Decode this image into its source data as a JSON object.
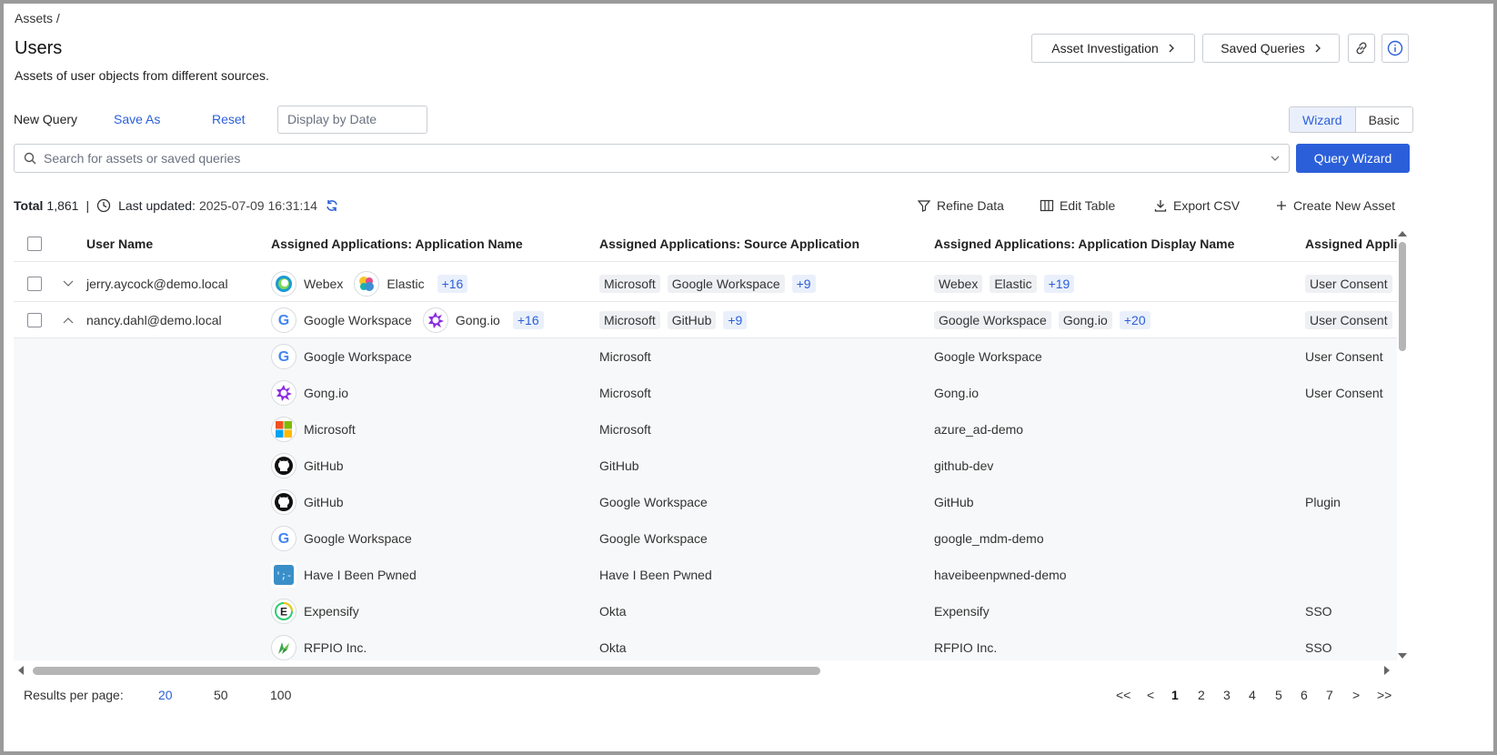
{
  "breadcrumb": "Assets /",
  "page": {
    "title": "Users",
    "subtitle": "Assets of user objects from different sources."
  },
  "header_buttons": {
    "asset_investigation": "Asset Investigation",
    "saved_queries": "Saved Queries"
  },
  "query_bar": {
    "new_query": "New Query",
    "save_as": "Save As",
    "reset": "Reset",
    "display_by_date_placeholder": "Display by Date",
    "mode_wizard": "Wizard",
    "mode_basic": "Basic",
    "search_placeholder": "Search for assets or saved queries",
    "query_wizard": "Query Wizard"
  },
  "status": {
    "total_label": "Total",
    "total_value": "1,861",
    "separator": "|",
    "last_updated_label": "Last updated:",
    "last_updated_value": "2025-07-09 16:31:14"
  },
  "toolbar": {
    "refine_data": "Refine Data",
    "edit_table": "Edit Table",
    "export_csv": "Export CSV",
    "create_new_asset": "Create New Asset"
  },
  "columns": {
    "user_name": "User Name",
    "app_name": "Assigned Applications: Application Name",
    "source_app": "Assigned Applications: Source Application",
    "display_name": "Assigned Applications: Application Display Name",
    "assigned_applic": "Assigned Applic"
  },
  "rows": [
    {
      "user": "jerry.aycock@demo.local",
      "app1": "Webex",
      "app2": "Elastic",
      "app_more": "+16",
      "src1": "Microsoft",
      "src2": "Google Workspace",
      "src_more": "+9",
      "disp1": "Webex",
      "disp2": "Elastic",
      "disp_more": "+19",
      "extra": "User Consent"
    },
    {
      "user": "nancy.dahl@demo.local",
      "app1": "Google Workspace",
      "app2": "Gong.io",
      "app_more": "+16",
      "src1": "Microsoft",
      "src2": "GitHub",
      "src_more": "+9",
      "disp1": "Google Workspace",
      "disp2": "Gong.io",
      "disp_more": "+20",
      "extra": "User Consent"
    }
  ],
  "subrows": [
    {
      "app": "Google Workspace",
      "icon": "google-icon",
      "source": "Microsoft",
      "display": "Google Workspace",
      "extra": "User Consent"
    },
    {
      "app": "Gong.io",
      "icon": "gong-icon",
      "source": "Microsoft",
      "display": "Gong.io",
      "extra": "User Consent"
    },
    {
      "app": "Microsoft",
      "icon": "microsoft-icon",
      "source": "Microsoft",
      "display": "azure_ad-demo",
      "extra": ""
    },
    {
      "app": "GitHub",
      "icon": "github-icon",
      "source": "GitHub",
      "display": "github-dev",
      "extra": ""
    },
    {
      "app": "GitHub",
      "icon": "github-icon",
      "source": "Google Workspace",
      "display": "GitHub",
      "extra": "Plugin"
    },
    {
      "app": "Google Workspace",
      "icon": "google-icon",
      "source": "Google Workspace",
      "display": "google_mdm-demo",
      "extra": ""
    },
    {
      "app": "Have I Been Pwned",
      "icon": "hibp-icon",
      "source": "Have I Been Pwned",
      "display": "haveibeenpwned-demo",
      "extra": ""
    },
    {
      "app": "Expensify",
      "icon": "expensify-icon",
      "source": "Okta",
      "display": "Expensify",
      "extra": "SSO"
    },
    {
      "app": "RFPIO Inc.",
      "icon": "rfpio-icon",
      "source": "Okta",
      "display": "RFPIO Inc.",
      "extra": "SSO"
    }
  ],
  "footer": {
    "results_per_page": "Results per page:",
    "options": [
      "20",
      "50",
      "100"
    ],
    "selected": "20"
  },
  "pagination": {
    "first": "<<",
    "prev": "<",
    "pages": [
      "1",
      "2",
      "3",
      "4",
      "5",
      "6",
      "7"
    ],
    "current": "1",
    "next": ">",
    "last": ">>"
  },
  "colors": {
    "accent": "#2b5fd9",
    "border": "#c9cdd3"
  }
}
